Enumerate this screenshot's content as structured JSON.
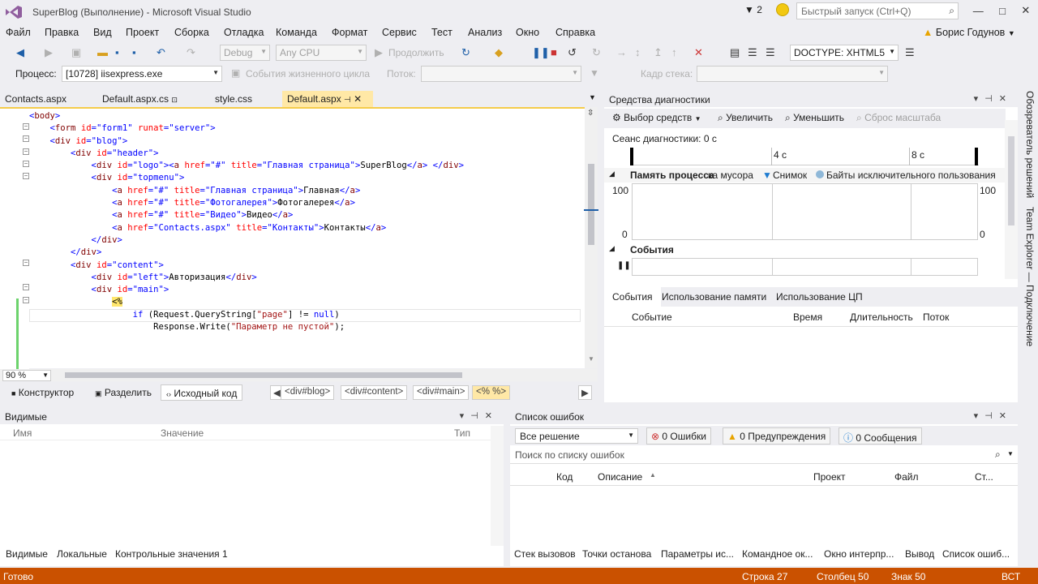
{
  "titlebar": {
    "title": "SuperBlog (Выполнение) - Microsoft Visual Studio",
    "notif_count": "2",
    "quick_launch": "Быстрый запуск (Ctrl+Q)"
  },
  "menu": [
    "Файл",
    "Правка",
    "Вид",
    "Проект",
    "Сборка",
    "Отладка",
    "Команда",
    "Формат",
    "Сервис",
    "Тест",
    "Анализ",
    "Окно",
    "Справка"
  ],
  "user": "Борис Годунов",
  "toolbar1": {
    "config": "Debug",
    "platform": "Any CPU",
    "continue": "Продолжить",
    "doctype": "DOCTYPE: XHTML5"
  },
  "toolbar2": {
    "process_label": "Процесс:",
    "process": "[10728] iisexpress.exe",
    "lifecycle": "События жизненного цикла",
    "thread_label": "Поток:",
    "stack_label": "Кадр стека:"
  },
  "tabs": [
    "Contacts.aspx",
    "Default.aspx.cs",
    "style.css",
    "Default.aspx"
  ],
  "editor": {
    "zoom": "90 %",
    "lines": [
      "<body>",
      "    <form id=\"form1\" runat=\"server\">",
      "    <div id=\"blog\">",
      "        <div id=\"header\">",
      "            <div id=\"logo\"><a href=\"#\" title=\"Главная страница\">SuperBlog</a> </div>",
      "            <div id=\"topmenu\">",
      "                <a href=\"#\" title=\"Главная страница\">Главная</a>",
      "                <a href=\"#\" title=\"Фотогалерея\">Фотогалерея</a>",
      "                <a href=\"#\" title=\"Видео\">Видео</a>",
      "                <a href=\"Contacts.aspx\" title=\"Контакты\">Контакты</a>",
      "            </div>",
      "        </div>",
      "        <div id=\"content\">",
      "            <div id=\"left\">Авторизация</div>",
      "            <div id=\"main\">",
      "                <%",
      "                    if (Request.QueryString[\"page\"] != null)",
      "                        Response.Write(\"Параметр не пустой\");"
    ]
  },
  "viewbar": {
    "designer": "Конструктор",
    "split": "Разделить",
    "source": "Исходный код",
    "crumbs": [
      "<div#blog>",
      "<div#content>",
      "<div#main>",
      "<% %>"
    ]
  },
  "diag": {
    "title": "Средства диагностики",
    "select": "Выбор средств",
    "zoom_in": "Увеличить",
    "zoom_out": "Уменьшить",
    "reset": "Сброс масштаба",
    "session": "Сеанс диагностики: 0 с",
    "t4": "4 с",
    "t8": "8 с",
    "mem_title": "Память процесса",
    "gc": "ка мусора",
    "snapshot": "Снимок",
    "bytes": "Байты исключительного пользования",
    "y_max": "100",
    "y_min": "0",
    "events": "События",
    "tabs": [
      "События",
      "Использование памяти",
      "Использование ЦП"
    ],
    "cols": [
      "Событие",
      "Время",
      "Длительность",
      "Поток"
    ]
  },
  "locals": {
    "title": "Видимые",
    "cols": [
      "Имя",
      "Значение",
      "Тип"
    ],
    "tabs": [
      "Видимые",
      "Локальные",
      "Контрольные значения 1"
    ]
  },
  "errors": {
    "title": "Список ошибок",
    "scope": "Все решение",
    "errors_btn": "0 Ошибки",
    "warnings_btn": "0 Предупреждения",
    "messages_btn": "0 Сообщения",
    "search": "Поиск по списку ошибок",
    "cols": [
      "Код",
      "Описание",
      "Проект",
      "Файл",
      "Ст..."
    ],
    "tabs": [
      "Стек вызовов",
      "Точки останова",
      "Параметры ис...",
      "Командное ок...",
      "Окно интерпр...",
      "Вывод",
      "Список ошиб..."
    ]
  },
  "side": {
    "solution": "Обозреватель решений",
    "team": "Team Explorer — Подключение"
  },
  "status": {
    "ready": "Готово",
    "line": "Строка 27",
    "col": "Столбец 50",
    "char": "Знак 50",
    "mode": "ВСТ"
  },
  "colors": {
    "accent": "#007acc",
    "status": "#ca5100",
    "active_tab": "#ffe8a6"
  }
}
